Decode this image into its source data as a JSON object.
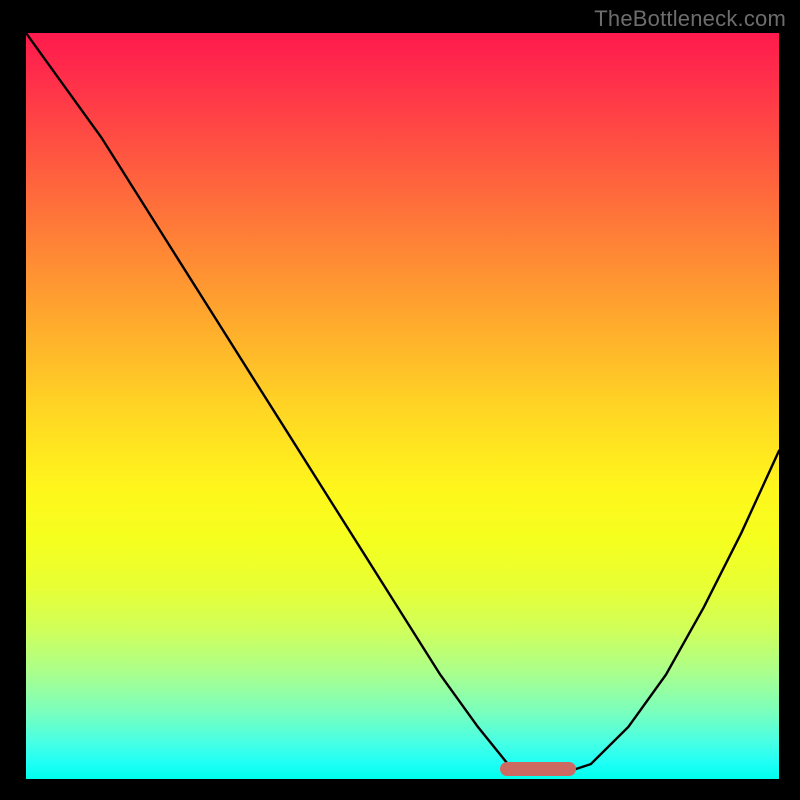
{
  "watermark": "TheBottleneck.com",
  "chart_data": {
    "type": "line",
    "title": "",
    "xlabel": "",
    "ylabel": "",
    "xlim": [
      0,
      100
    ],
    "ylim": [
      0,
      100
    ],
    "grid": false,
    "legend": false,
    "background_gradient": {
      "stops": [
        {
          "pos": 0,
          "color": "#ff1a4d"
        },
        {
          "pos": 17,
          "color": "#ff5840"
        },
        {
          "pos": 39,
          "color": "#ffab2d"
        },
        {
          "pos": 61,
          "color": "#fff61c"
        },
        {
          "pos": 80,
          "color": "#d0ff5a"
        },
        {
          "pos": 95,
          "color": "#48ffe3"
        },
        {
          "pos": 100,
          "color": "#00ffee"
        }
      ]
    },
    "series": [
      {
        "name": "bottleneck-curve",
        "color": "#000000",
        "x": [
          0,
          5,
          10,
          15,
          20,
          25,
          30,
          35,
          40,
          45,
          50,
          55,
          60,
          64,
          67,
          70,
          72,
          75,
          80,
          85,
          90,
          95,
          100
        ],
        "y": [
          100,
          93,
          86,
          78,
          70,
          62,
          54,
          46,
          38,
          30,
          22,
          14,
          7,
          2,
          1,
          1,
          1,
          2,
          7,
          14,
          23,
          33,
          44
        ]
      }
    ],
    "marker": {
      "name": "optimal-range",
      "x_start": 63,
      "x_end": 73,
      "y": 1.3,
      "color": "#cc6a62"
    }
  }
}
